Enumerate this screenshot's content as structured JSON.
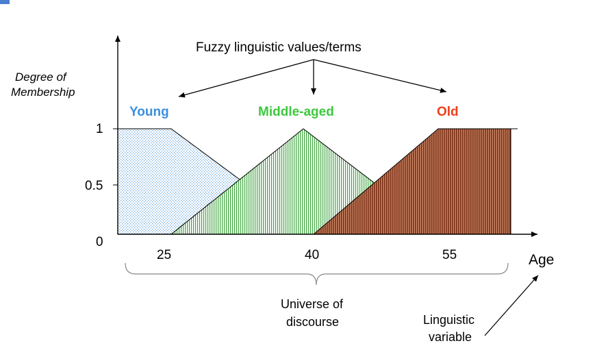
{
  "title": "Fuzzy linguistic values/terms",
  "y_axis_label_line1": "Degree of",
  "y_axis_label_line2": "Membership",
  "y_ticks": [
    "1",
    "0.5",
    "0"
  ],
  "x_ticks": [
    "25",
    "40",
    "55"
  ],
  "x_axis_label": "Age",
  "terms": [
    {
      "name": "Young",
      "color": "#3b8fe0",
      "fill": "#9fc7ee"
    },
    {
      "name": "Middle-aged",
      "color": "#3ec83e",
      "fill": "#3aa03a"
    },
    {
      "name": "Old",
      "color": "#ee3f1c",
      "fill": "#8b3a1a"
    }
  ],
  "universe_label_line1": "Universe of",
  "universe_label_line2": "discourse",
  "variable_label_line1": "Linguistic",
  "variable_label_line2": "variable"
}
